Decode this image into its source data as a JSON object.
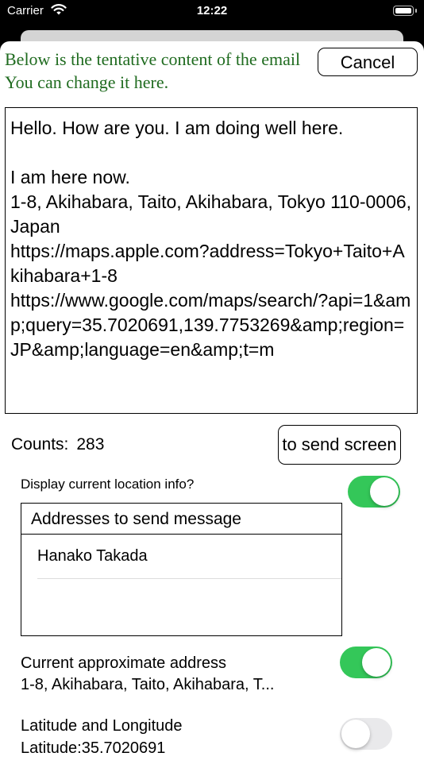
{
  "status_bar": {
    "carrier": "Carrier",
    "time": "12:22"
  },
  "intro": {
    "line1": "Below is the tentative content of the email",
    "line2": "You can change it here."
  },
  "cancel_label": "Cancel",
  "mail_body": "Hello. How are you. I am doing well here.\n\nI am here now.\n1-8, Akihabara, Taito, Akihabara, Tokyo 110-0006, Japan\nhttps://maps.apple.com?address=Tokyo+Taito+Akihabara+1-8\nhttps://www.google.com/maps/search/?api=1&amp;query=35.7020691,139.7753269&amp;region=JP&amp;language=en&amp;t=m",
  "counts": {
    "label": "Counts:",
    "value": "283"
  },
  "to_send_label": "to send screen",
  "display_location": {
    "label": "Display current location info?",
    "on": true
  },
  "addresses": {
    "header": "Addresses to send message",
    "items": [
      "Hanako Takada"
    ]
  },
  "current_address": {
    "label": "Current approximate address",
    "value": "1-8, Akihabara, Taito, Akihabara, T...",
    "on": true
  },
  "lat_lng": {
    "label": "Latitude and Longitude",
    "value": "Latitude:35.7020691",
    "on": false
  },
  "colors": {
    "intro_text": "#1f6b1f",
    "toggle_on": "#34c759",
    "toggle_off": "#e9e9eb"
  }
}
